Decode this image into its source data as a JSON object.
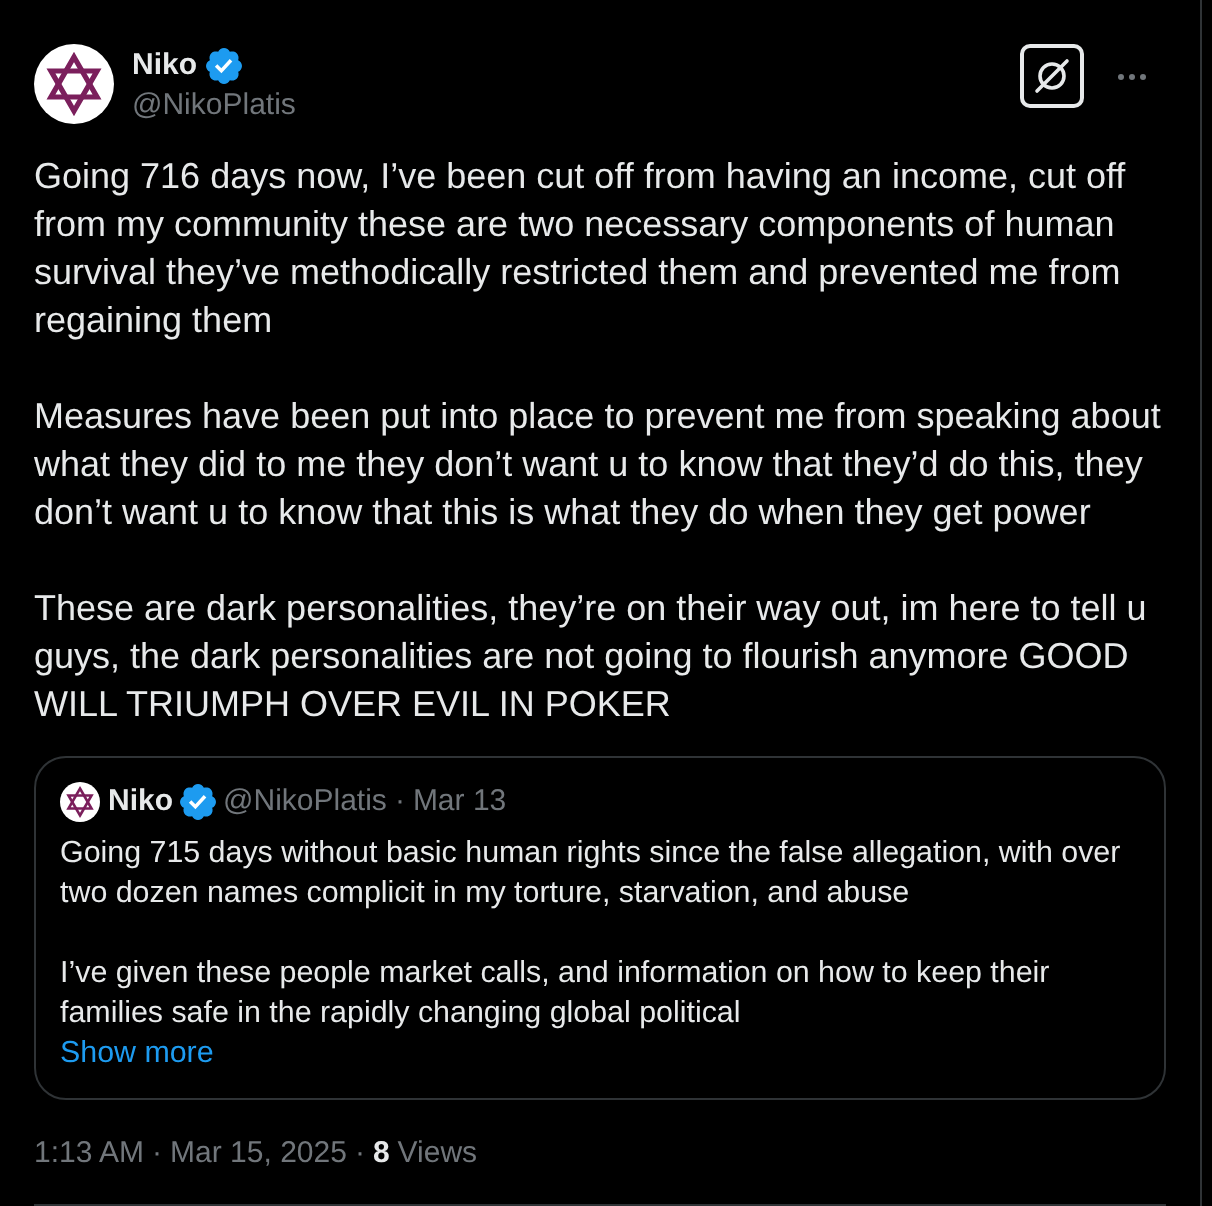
{
  "author": {
    "name": "Niko",
    "verified": true,
    "handle": "@NikoPlatis"
  },
  "post": {
    "paragraphs": [
      "Going 716 days now, I’ve been cut off from having an income, cut off from my community these are two necessary components of human survival they’ve methodically restricted them and prevented me from regaining them",
      "Measures have been put into place to prevent me from speaking about what they did to me they don’t want u to know that they’d do this, they don’t want u to know that this is what they do when they get power",
      "These are dark personalities, they’re on their way out, im here to tell u guys, the dark personalities are not going to flourish anymore GOOD WILL TRIUMPH OVER EVIL IN POKER"
    ]
  },
  "quote": {
    "author": {
      "name": "Niko",
      "verified": true,
      "handle": "@NikoPlatis"
    },
    "separator": "·",
    "date": "Mar 13",
    "paragraphs": [
      "Going 715 days without basic human rights since the false allegation, with over two dozen names complicit in my torture, starvation, and abuse",
      "I’ve given these people market calls, and information on how to keep their families safe in the rapidly changing global political"
    ],
    "show_more": "Show more"
  },
  "meta": [
    {
      "kind": "time",
      "text": "1:13 AM"
    },
    {
      "kind": "separator",
      "text": "·"
    },
    {
      "kind": "date",
      "text": "Mar 15, 2025"
    },
    {
      "kind": "separator",
      "text": "·"
    },
    {
      "kind": "views_count",
      "text": "8"
    },
    {
      "kind": "views_label",
      "text": "Views"
    }
  ]
}
